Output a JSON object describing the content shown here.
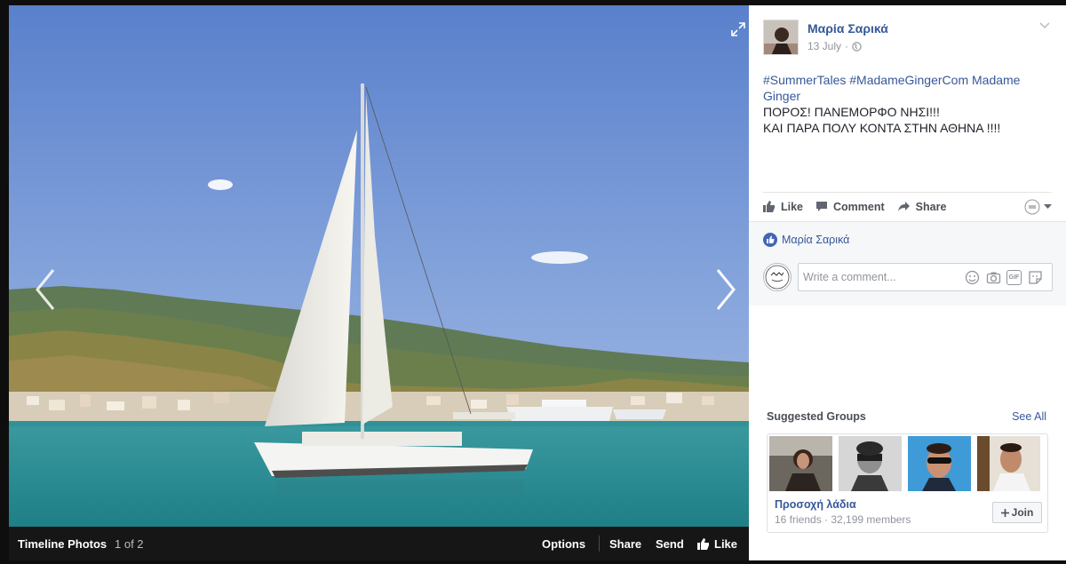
{
  "viewer": {
    "bar_title": "Timeline Photos",
    "bar_count": "1 of 2",
    "options_label": "Options",
    "share_label": "Share",
    "send_label": "Send",
    "like_label": "Like"
  },
  "post": {
    "author": "Μαρία Σαρικά",
    "date": "13 July",
    "separator": "·",
    "hashtags": [
      "#SummerTales",
      "#MadameGingerCom",
      "Madame Ginger"
    ],
    "lines": [
      "ΠΟΡΟΣ! ΠΑΝΕΜΟΡΦΟ ΝΗΣΙ!!!",
      "ΚΑΙ ΠΑΡΑ ΠΟΛΥ ΚΟΝΤΑ ΣΤΗΝ ΑΘΗΝΑ !!!!"
    ]
  },
  "actions": {
    "like": "Like",
    "comment": "Comment",
    "share": "Share"
  },
  "reactions": {
    "liked_by": "Μαρία Σαρικά"
  },
  "comment": {
    "placeholder": "Write a comment...",
    "gif_label": "GIF"
  },
  "suggested_groups": {
    "title": "Suggested Groups",
    "see_all": "See All",
    "group_name": "Προσοχή λάδια",
    "stats": "16 friends · 32,199 members",
    "join_label": "Join"
  },
  "colors": {
    "link": "#365899",
    "like_blue": "#4267b2",
    "sea": "#2f8f96",
    "sky": "#7fa0d8"
  },
  "icons": [
    "expand-icon",
    "chevron-left-icon",
    "chevron-right-icon",
    "thumbs-up-icon",
    "comment-icon",
    "share-arrow-icon",
    "globe-icon",
    "chevron-down-icon",
    "emoji-icon",
    "camera-icon",
    "gif-icon",
    "sticker-icon",
    "plus-icon"
  ]
}
